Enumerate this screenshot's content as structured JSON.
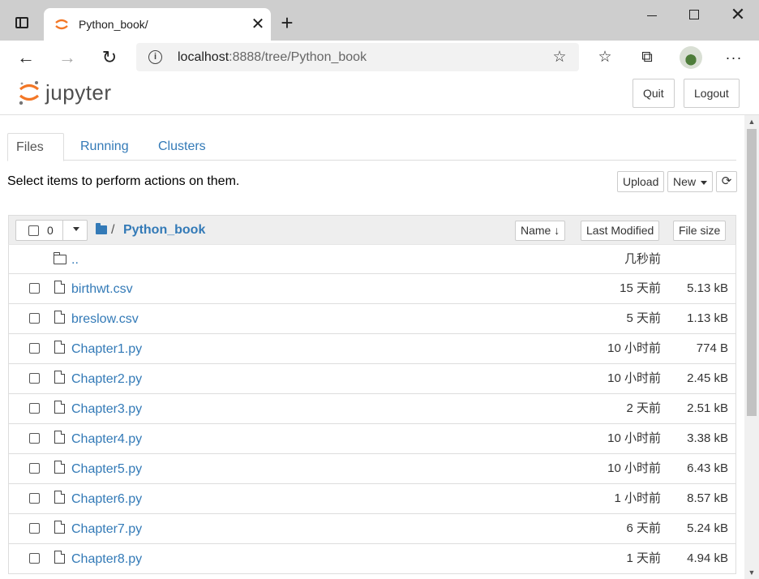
{
  "browser": {
    "tab_title": "Python_book/",
    "tab_close": "✕",
    "new_tab": "+",
    "url_host": "localhost",
    "url_rest": ":8888/tree/Python_book",
    "icons": {
      "tab_menu": "tab-actions-icon",
      "back": "arrow-left-icon",
      "forward": "arrow-right-icon",
      "reload": "reload-icon",
      "info": "info-icon",
      "add_favorite": "star-add-icon",
      "favorites": "favorites-icon",
      "collections": "collections-icon",
      "profile": "profile-avatar",
      "more": "more-icon"
    }
  },
  "jupyter": {
    "logo_text": "jupyter",
    "quit_label": "Quit",
    "logout_label": "Logout",
    "brand_color": "#f37726"
  },
  "tabs": [
    {
      "label": "Files",
      "active": true
    },
    {
      "label": "Running",
      "active": false
    },
    {
      "label": "Clusters",
      "active": false
    }
  ],
  "toolbar": {
    "instructions": "Select items to perform actions on them.",
    "upload_label": "Upload",
    "new_label": "New",
    "refresh_icon": "refresh-icon"
  },
  "list_header": {
    "selected_count": "0",
    "breadcrumb_sep": "/",
    "current_dir": "Python_book",
    "sort_name": "Name",
    "sort_name_arrow": "↓",
    "sort_modified": "Last Modified",
    "sort_size": "File size"
  },
  "files": [
    {
      "name": "..",
      "type": "parent",
      "modified": "几秒前",
      "size": ""
    },
    {
      "name": "birthwt.csv",
      "type": "file",
      "modified": "15 天前",
      "size": "5.13 kB"
    },
    {
      "name": "breslow.csv",
      "type": "file",
      "modified": "5 天前",
      "size": "1.13 kB"
    },
    {
      "name": "Chapter1.py",
      "type": "file",
      "modified": "10 小时前",
      "size": "774 B"
    },
    {
      "name": "Chapter2.py",
      "type": "file",
      "modified": "10 小时前",
      "size": "2.45 kB"
    },
    {
      "name": "Chapter3.py",
      "type": "file",
      "modified": "2 天前",
      "size": "2.51 kB"
    },
    {
      "name": "Chapter4.py",
      "type": "file",
      "modified": "10 小时前",
      "size": "3.38 kB"
    },
    {
      "name": "Chapter5.py",
      "type": "file",
      "modified": "10 小时前",
      "size": "6.43 kB"
    },
    {
      "name": "Chapter6.py",
      "type": "file",
      "modified": "1 小时前",
      "size": "8.57 kB"
    },
    {
      "name": "Chapter7.py",
      "type": "file",
      "modified": "6 天前",
      "size": "5.24 kB"
    },
    {
      "name": "Chapter8.py",
      "type": "file",
      "modified": "1 天前",
      "size": "4.94 kB"
    }
  ],
  "colors": {
    "link": "#337ab7",
    "chrome_bg": "#cecece",
    "header_bg": "#eeeeee"
  }
}
